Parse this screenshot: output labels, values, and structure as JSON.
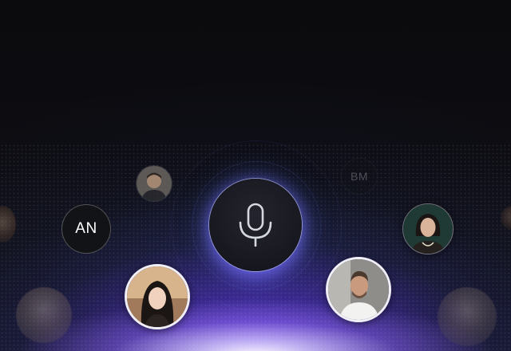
{
  "mic_button": {
    "icon": "microphone-icon"
  },
  "participants": [
    {
      "initials": "AN"
    },
    {
      "initials": "BM"
    }
  ],
  "colors": {
    "glow": "#7a5cff",
    "mic_ring": "#d2d7ff",
    "background": "#0b0b0e"
  }
}
